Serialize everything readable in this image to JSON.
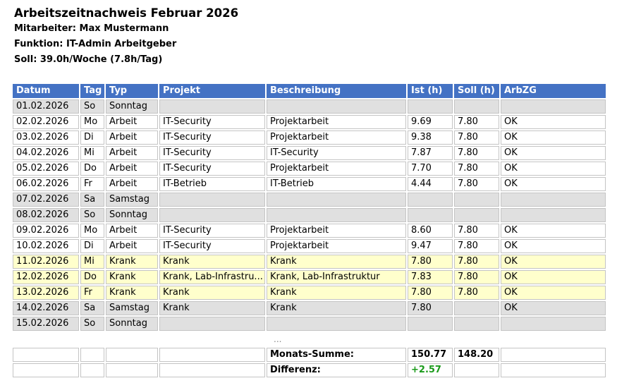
{
  "header": {
    "title": "Arbeitszeitnachweis Februar 2026",
    "employee": "Mitarbeiter: Max Mustermann",
    "function": "Funktion: IT-Admin Arbeitgeber",
    "target": "Soll: 39.0h/Woche (7.8h/Tag)"
  },
  "table": {
    "columns": [
      "Datum",
      "Tag",
      "Typ",
      "Projekt",
      "Beschreibung",
      "Ist (h)",
      "Soll (h)",
      "ArbZG"
    ],
    "rows": [
      {
        "kind": "weekend",
        "cells": [
          "01.02.2026",
          "So",
          "Sonntag",
          "",
          "",
          "",
          "",
          ""
        ]
      },
      {
        "kind": "work",
        "cells": [
          "02.02.2026",
          "Mo",
          "Arbeit",
          "IT-Security",
          "Projektarbeit",
          "9.69",
          "7.80",
          "OK"
        ]
      },
      {
        "kind": "work",
        "cells": [
          "03.02.2026",
          "Di",
          "Arbeit",
          "IT-Security",
          "Projektarbeit",
          "9.38",
          "7.80",
          "OK"
        ]
      },
      {
        "kind": "work",
        "cells": [
          "04.02.2026",
          "Mi",
          "Arbeit",
          "IT-Security",
          "IT-Security",
          "7.87",
          "7.80",
          "OK"
        ]
      },
      {
        "kind": "work",
        "cells": [
          "05.02.2026",
          "Do",
          "Arbeit",
          "IT-Security",
          "Projektarbeit",
          "7.70",
          "7.80",
          "OK"
        ]
      },
      {
        "kind": "work",
        "cells": [
          "06.02.2026",
          "Fr",
          "Arbeit",
          "IT-Betrieb",
          "IT-Betrieb",
          "4.44",
          "7.80",
          "OK"
        ]
      },
      {
        "kind": "weekend",
        "cells": [
          "07.02.2026",
          "Sa",
          "Samstag",
          "",
          "",
          "",
          "",
          ""
        ]
      },
      {
        "kind": "weekend",
        "cells": [
          "08.02.2026",
          "So",
          "Sonntag",
          "",
          "",
          "",
          "",
          ""
        ]
      },
      {
        "kind": "work",
        "cells": [
          "09.02.2026",
          "Mo",
          "Arbeit",
          "IT-Security",
          "Projektarbeit",
          "8.60",
          "7.80",
          "OK"
        ]
      },
      {
        "kind": "work",
        "cells": [
          "10.02.2026",
          "Di",
          "Arbeit",
          "IT-Security",
          "Projektarbeit",
          "9.47",
          "7.80",
          "OK"
        ]
      },
      {
        "kind": "sick",
        "cells": [
          "11.02.2026",
          "Mi",
          "Krank",
          "Krank",
          "Krank",
          "7.80",
          "7.80",
          "OK"
        ]
      },
      {
        "kind": "sick",
        "cells": [
          "12.02.2026",
          "Do",
          "Krank",
          "Krank, Lab-Infrastru...",
          "Krank, Lab-Infrastruktur",
          "7.83",
          "7.80",
          "OK"
        ]
      },
      {
        "kind": "sick",
        "cells": [
          "13.02.2026",
          "Fr",
          "Krank",
          "Krank",
          "Krank",
          "7.80",
          "7.80",
          "OK"
        ]
      },
      {
        "kind": "weekend",
        "cells": [
          "14.02.2026",
          "Sa",
          "Samstag",
          "Krank",
          "Krank",
          "7.80",
          "",
          "OK"
        ]
      },
      {
        "kind": "weekend",
        "cells": [
          "15.02.2026",
          "So",
          "Sonntag",
          "",
          "",
          "",
          "",
          ""
        ]
      }
    ],
    "ellipsis": "...",
    "summary": {
      "sum_label": "Monats-Summe:",
      "sum_ist": "150.77",
      "sum_soll": "148.20",
      "diff_label": "Differenz:",
      "diff_value": "+2.57"
    },
    "colors": {
      "header_bg": "#4472c4",
      "weekend_bg": "#e0e0e0",
      "sick_bg": "#ffffcc",
      "diff_positive": "#1a9a1a"
    }
  }
}
